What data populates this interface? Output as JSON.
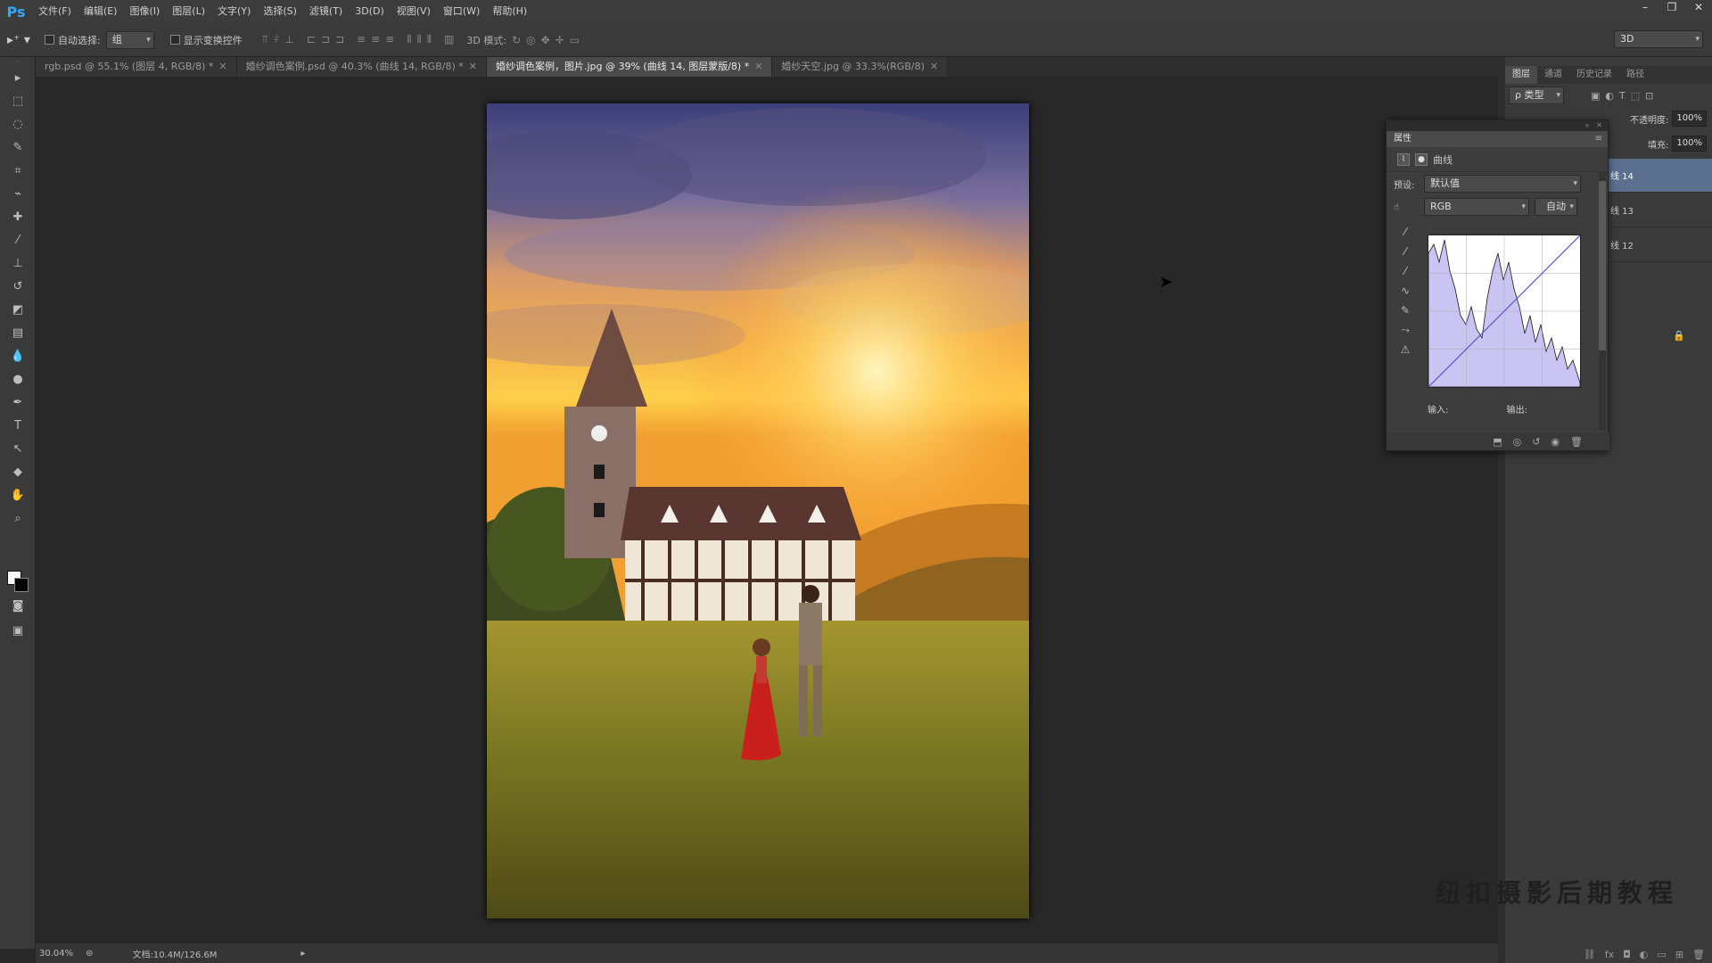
{
  "app": {
    "logo": "Ps"
  },
  "menu": [
    "文件(F)",
    "编辑(E)",
    "图像(I)",
    "图层(L)",
    "文字(Y)",
    "选择(S)",
    "滤镜(T)",
    "3D(D)",
    "视图(V)",
    "窗口(W)",
    "帮助(H)"
  ],
  "window_controls": [
    "–",
    "❐",
    "✕"
  ],
  "options": {
    "auto_select_label": "自动选择:",
    "auto_select_value": "组",
    "show_transform_label": "显示变换控件",
    "mode_3d_label": "3D 模式:",
    "workspace_value": "3D"
  },
  "tabs": [
    {
      "label": "rgb.psd @ 55.1% (图层 4, RGB/8) *",
      "active": false
    },
    {
      "label": "婚纱调色案例.psd @ 40.3% (曲线 14, RGB/8) *",
      "active": false
    },
    {
      "label": "婚纱调色案例，图片.jpg @ 39% (曲线 14, 图层蒙版/8) *",
      "active": true
    },
    {
      "label": "婚纱天空.jpg @ 33.3%(RGB/8)",
      "active": false
    }
  ],
  "status": {
    "zoom": "30.04%",
    "doc": "文档:10.4M/126.6M"
  },
  "layers_panel": {
    "tabs": [
      "图层",
      "通道",
      "历史记录",
      "路径"
    ],
    "filter_label": "ρ 类型",
    "opacity_label": "不透明度:",
    "opacity_value": "100%",
    "fill_label": "填充:",
    "fill_value": "100%",
    "rows": [
      "线 14",
      "线 13",
      "线 12"
    ]
  },
  "properties": {
    "title": "属性",
    "adjust_name": "曲线",
    "preset_label": "预设:",
    "preset_value": "默认值",
    "channel_value": "RGB",
    "auto_button": "自动",
    "input_label": "输入:",
    "output_label": "输出:"
  },
  "watermark": "纽扣摄影后期教程",
  "colors": {
    "accent": "#31a8ff",
    "selected_layer": "#5b6f8f",
    "curve_fill": "#c9c4f2"
  }
}
